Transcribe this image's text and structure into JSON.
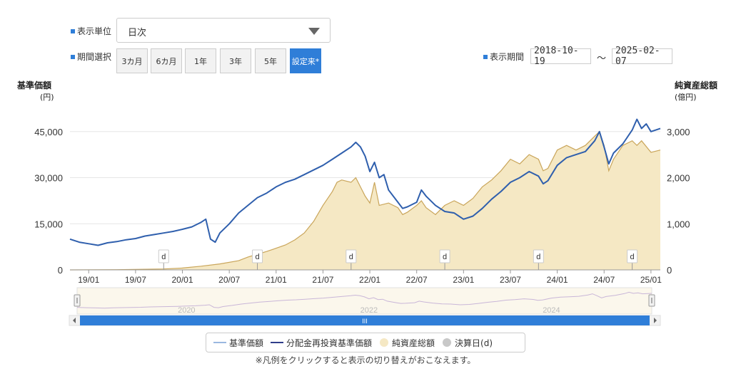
{
  "controls": {
    "unit_label": "表示単位",
    "unit_value": "日次",
    "period_label": "期間選択",
    "period_buttons": [
      "3カ月",
      "6カ月",
      "1年",
      "3年",
      "5年",
      "設定来*"
    ],
    "display_period_label": "表示期間",
    "date_from": "2018-10-19",
    "date_sep": "〜",
    "date_to": "2025-02-07"
  },
  "legend": {
    "items": [
      "基準価額",
      "分配金再投資基準価額",
      "純資産総額",
      "決算日(d)"
    ]
  },
  "note": "※凡例をクリックすると表示の切り替えがおこなえます。",
  "navigator": {
    "years": [
      "2020",
      "2022",
      "2024"
    ]
  },
  "scrollbar": {
    "grip": "III"
  },
  "colors": {
    "nav_line": "#2f5fad",
    "base_line": "#9ab8e0",
    "aum_fill": "#f5e8c4",
    "aum_line": "#c9a55a",
    "accent": "#2f7ed8"
  },
  "chart_data": {
    "type": "line",
    "left_axis": {
      "title": "基準価額",
      "unit": "(円)",
      "ticks": [
        "0",
        "15,000",
        "30,000",
        "45,000"
      ],
      "range": [
        0,
        60000
      ]
    },
    "right_axis": {
      "title": "純資産総額",
      "unit": "(億円)",
      "ticks": [
        "0",
        "1,000",
        "2,000",
        "3,000"
      ],
      "range": [
        0,
        4000
      ]
    },
    "x_ticks": [
      {
        "label": "19/01",
        "t": 0.2
      },
      {
        "label": "19/07",
        "t": 0.7
      },
      {
        "label": "20/01",
        "t": 1.2
      },
      {
        "label": "20/07",
        "t": 1.7
      },
      {
        "label": "21/01",
        "t": 2.2
      },
      {
        "label": "21/07",
        "t": 2.7
      },
      {
        "label": "22/01",
        "t": 3.2
      },
      {
        "label": "22/07",
        "t": 3.7
      },
      {
        "label": "23/01",
        "t": 4.2
      },
      {
        "label": "23/07",
        "t": 4.7
      },
      {
        "label": "24/01",
        "t": 5.2
      },
      {
        "label": "24/07",
        "t": 5.7
      },
      {
        "label": "25/01",
        "t": 6.2
      }
    ],
    "x_range": [
      0,
      6.3
    ],
    "settlement_markers": {
      "label": "d",
      "t": [
        1.0,
        2.0,
        3.0,
        4.0,
        5.0,
        6.0
      ]
    },
    "series": [
      {
        "name": "分配金再投資基準価額",
        "axis": "left",
        "points": [
          [
            0,
            10000
          ],
          [
            0.1,
            9000
          ],
          [
            0.2,
            8500
          ],
          [
            0.3,
            8000
          ],
          [
            0.4,
            8800
          ],
          [
            0.5,
            9200
          ],
          [
            0.6,
            9800
          ],
          [
            0.7,
            10200
          ],
          [
            0.8,
            11000
          ],
          [
            0.9,
            11500
          ],
          [
            1.0,
            12000
          ],
          [
            1.1,
            12500
          ],
          [
            1.2,
            13200
          ],
          [
            1.3,
            14000
          ],
          [
            1.4,
            15500
          ],
          [
            1.45,
            16500
          ],
          [
            1.5,
            10000
          ],
          [
            1.55,
            9000
          ],
          [
            1.6,
            12000
          ],
          [
            1.7,
            15000
          ],
          [
            1.8,
            18500
          ],
          [
            1.9,
            21000
          ],
          [
            2.0,
            23500
          ],
          [
            2.1,
            25000
          ],
          [
            2.2,
            27000
          ],
          [
            2.3,
            28500
          ],
          [
            2.4,
            29500
          ],
          [
            2.5,
            31000
          ],
          [
            2.6,
            32500
          ],
          [
            2.7,
            34000
          ],
          [
            2.8,
            36000
          ],
          [
            2.9,
            38000
          ],
          [
            3.0,
            40000
          ],
          [
            3.05,
            41500
          ],
          [
            3.1,
            40000
          ],
          [
            3.15,
            37000
          ],
          [
            3.2,
            32000
          ],
          [
            3.25,
            35000
          ],
          [
            3.3,
            30000
          ],
          [
            3.35,
            31000
          ],
          [
            3.4,
            26000
          ],
          [
            3.5,
            22000
          ],
          [
            3.55,
            20000
          ],
          [
            3.6,
            20500
          ],
          [
            3.7,
            22000
          ],
          [
            3.75,
            26000
          ],
          [
            3.8,
            24000
          ],
          [
            3.9,
            21000
          ],
          [
            4.0,
            19000
          ],
          [
            4.1,
            18500
          ],
          [
            4.15,
            17500
          ],
          [
            4.2,
            16500
          ],
          [
            4.3,
            17500
          ],
          [
            4.4,
            20000
          ],
          [
            4.5,
            23000
          ],
          [
            4.6,
            25500
          ],
          [
            4.7,
            28500
          ],
          [
            4.8,
            30000
          ],
          [
            4.9,
            32000
          ],
          [
            5.0,
            30500
          ],
          [
            5.05,
            28000
          ],
          [
            5.1,
            29000
          ],
          [
            5.2,
            34000
          ],
          [
            5.3,
            36500
          ],
          [
            5.4,
            37500
          ],
          [
            5.5,
            38500
          ],
          [
            5.6,
            42000
          ],
          [
            5.65,
            45000
          ],
          [
            5.7,
            40000
          ],
          [
            5.75,
            34500
          ],
          [
            5.8,
            38000
          ],
          [
            5.9,
            41000
          ],
          [
            6.0,
            45500
          ],
          [
            6.05,
            49000
          ],
          [
            6.1,
            46000
          ],
          [
            6.15,
            47500
          ],
          [
            6.2,
            45000
          ],
          [
            6.3,
            46000
          ]
        ]
      },
      {
        "name": "純資産総額",
        "axis": "right",
        "points": [
          [
            0,
            0
          ],
          [
            0.5,
            5
          ],
          [
            1.0,
            20
          ],
          [
            1.2,
            40
          ],
          [
            1.4,
            80
          ],
          [
            1.6,
            130
          ],
          [
            1.8,
            200
          ],
          [
            1.9,
            280
          ],
          [
            2.0,
            340
          ],
          [
            2.1,
            400
          ],
          [
            2.2,
            470
          ],
          [
            2.3,
            540
          ],
          [
            2.4,
            650
          ],
          [
            2.5,
            800
          ],
          [
            2.6,
            1050
          ],
          [
            2.7,
            1400
          ],
          [
            2.8,
            1700
          ],
          [
            2.85,
            1900
          ],
          [
            2.9,
            1950
          ],
          [
            3.0,
            1900
          ],
          [
            3.05,
            2000
          ],
          [
            3.1,
            1800
          ],
          [
            3.15,
            1600
          ],
          [
            3.2,
            1450
          ],
          [
            3.25,
            1900
          ],
          [
            3.3,
            1400
          ],
          [
            3.4,
            1450
          ],
          [
            3.5,
            1350
          ],
          [
            3.55,
            1200
          ],
          [
            3.6,
            1250
          ],
          [
            3.7,
            1400
          ],
          [
            3.75,
            1500
          ],
          [
            3.8,
            1350
          ],
          [
            3.9,
            1200
          ],
          [
            4.0,
            1400
          ],
          [
            4.1,
            1500
          ],
          [
            4.2,
            1400
          ],
          [
            4.3,
            1550
          ],
          [
            4.4,
            1800
          ],
          [
            4.5,
            1950
          ],
          [
            4.6,
            2150
          ],
          [
            4.7,
            2400
          ],
          [
            4.8,
            2300
          ],
          [
            4.9,
            2500
          ],
          [
            5.0,
            2400
          ],
          [
            5.05,
            2150
          ],
          [
            5.1,
            2200
          ],
          [
            5.2,
            2600
          ],
          [
            5.3,
            2700
          ],
          [
            5.4,
            2600
          ],
          [
            5.5,
            2700
          ],
          [
            5.6,
            2900
          ],
          [
            5.65,
            3000
          ],
          [
            5.7,
            2700
          ],
          [
            5.75,
            2150
          ],
          [
            5.8,
            2400
          ],
          [
            5.9,
            2700
          ],
          [
            6.0,
            2800
          ],
          [
            6.05,
            2700
          ],
          [
            6.1,
            2800
          ],
          [
            6.2,
            2550
          ],
          [
            6.3,
            2600
          ]
        ]
      }
    ]
  }
}
